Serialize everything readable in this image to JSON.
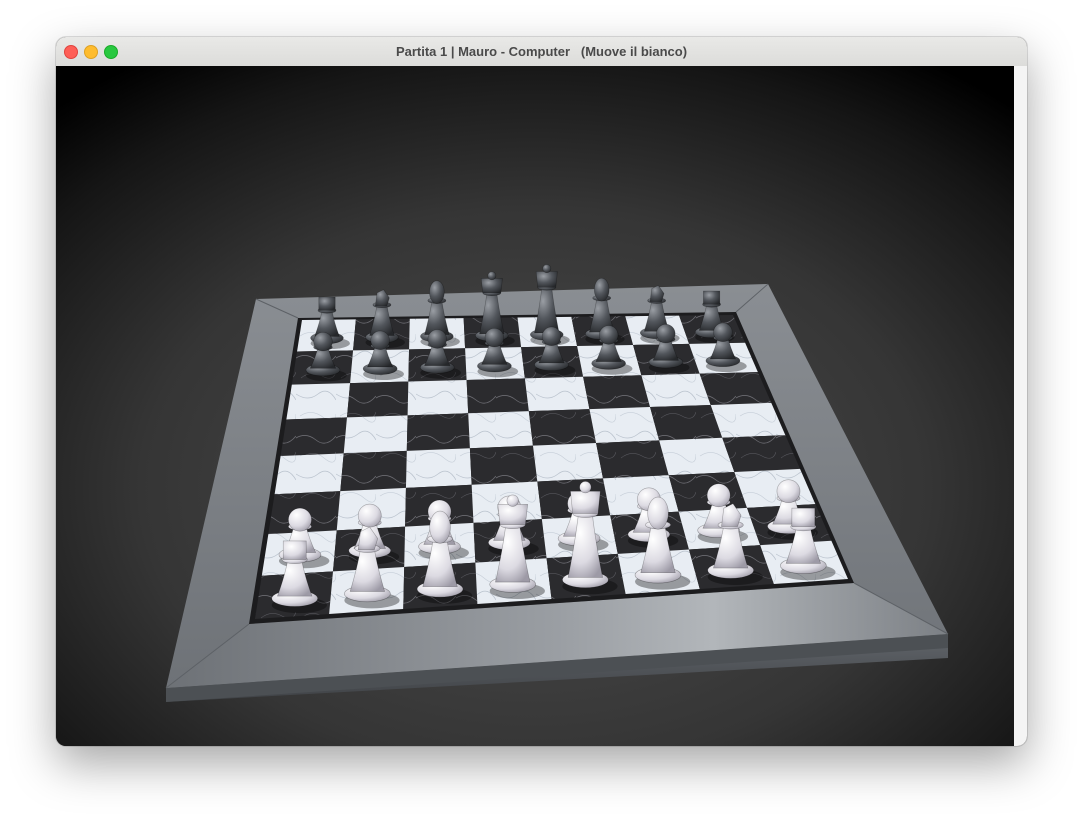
{
  "window": {
    "title": "Partita 1 | Mauro - Computer   (Muove il bianco)",
    "controls": [
      "close",
      "minimize",
      "zoom"
    ]
  },
  "scene": {
    "description_icon": "chessboard-3d",
    "background_color": "#2b2b2b",
    "board": {
      "frame_color": "#7d8186",
      "light_square_color": "#e6ecf2",
      "dark_square_color": "#2a2a2c"
    },
    "black_pieces_back_rank": [
      "rook",
      "knight",
      "bishop",
      "queen",
      "king",
      "bishop",
      "knight",
      "rook"
    ],
    "white_pieces_back_rank": [
      "rook",
      "knight",
      "bishop",
      "queen",
      "king",
      "bishop",
      "knight",
      "rook"
    ],
    "black_piece_color": "#4a4d52",
    "white_piece_color": "#e9e7ec"
  }
}
